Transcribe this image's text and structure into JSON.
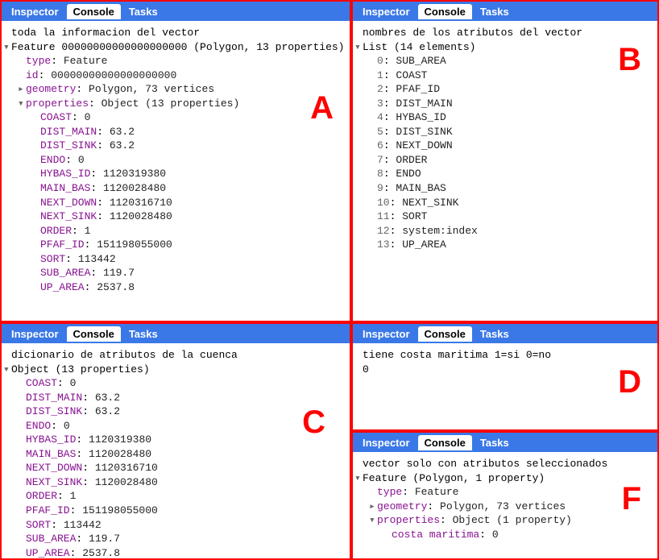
{
  "tabs": {
    "inspector": "Inspector",
    "console": "Console",
    "tasks": "Tasks"
  },
  "A": {
    "letter": "A",
    "msg": "toda la informacion del vector",
    "header": "Feature 00000000000000000000 (Polygon, 13 properties)",
    "type_key": "type",
    "type_val": "Feature",
    "id_key": "id",
    "id_val": "00000000000000000000",
    "geom_key": "geometry",
    "geom_val": "Polygon, 73 vertices",
    "props_key": "properties",
    "props_val": "Object (13 properties)",
    "props": [
      {
        "k": "COAST",
        "v": "0"
      },
      {
        "k": "DIST_MAIN",
        "v": "63.2"
      },
      {
        "k": "DIST_SINK",
        "v": "63.2"
      },
      {
        "k": "ENDO",
        "v": "0"
      },
      {
        "k": "HYBAS_ID",
        "v": "1120319380"
      },
      {
        "k": "MAIN_BAS",
        "v": "1120028480"
      },
      {
        "k": "NEXT_DOWN",
        "v": "1120316710"
      },
      {
        "k": "NEXT_SINK",
        "v": "1120028480"
      },
      {
        "k": "ORDER",
        "v": "1"
      },
      {
        "k": "PFAF_ID",
        "v": "151198055000"
      },
      {
        "k": "SORT",
        "v": "113442"
      },
      {
        "k": "SUB_AREA",
        "v": "119.7"
      },
      {
        "k": "UP_AREA",
        "v": "2537.8"
      }
    ]
  },
  "B": {
    "letter": "B",
    "msg": "nombres de los atributos del vector",
    "header": "List (14 elements)",
    "items": [
      "SUB_AREA",
      "COAST",
      "PFAF_ID",
      "DIST_MAIN",
      "HYBAS_ID",
      "DIST_SINK",
      "NEXT_DOWN",
      "ORDER",
      "ENDO",
      "MAIN_BAS",
      "NEXT_SINK",
      "SORT",
      "system:index",
      "UP_AREA"
    ]
  },
  "C": {
    "letter": "C",
    "msg": "dicionario de atributos de la cuenca",
    "header": "Object (13 properties)",
    "props": [
      {
        "k": "COAST",
        "v": "0"
      },
      {
        "k": "DIST_MAIN",
        "v": "63.2"
      },
      {
        "k": "DIST_SINK",
        "v": "63.2"
      },
      {
        "k": "ENDO",
        "v": "0"
      },
      {
        "k": "HYBAS_ID",
        "v": "1120319380"
      },
      {
        "k": "MAIN_BAS",
        "v": "1120028480"
      },
      {
        "k": "NEXT_DOWN",
        "v": "1120316710"
      },
      {
        "k": "NEXT_SINK",
        "v": "1120028480"
      },
      {
        "k": "ORDER",
        "v": "1"
      },
      {
        "k": "PFAF_ID",
        "v": "151198055000"
      },
      {
        "k": "SORT",
        "v": "113442"
      },
      {
        "k": "SUB_AREA",
        "v": "119.7"
      },
      {
        "k": "UP_AREA",
        "v": "2537.8"
      }
    ]
  },
  "D": {
    "letter": "D",
    "msg": "tiene costa maritima 1=si 0=no",
    "value": "0"
  },
  "F": {
    "letter": "F",
    "msg": "vector solo con atributos seleccionados",
    "header": "Feature (Polygon, 1 property)",
    "type_key": "type",
    "type_val": "Feature",
    "geom_key": "geometry",
    "geom_val": "Polygon, 73 vertices",
    "props_key": "properties",
    "props_val": "Object (1 property)",
    "prop_k": "costa maritima",
    "prop_v": "0"
  }
}
